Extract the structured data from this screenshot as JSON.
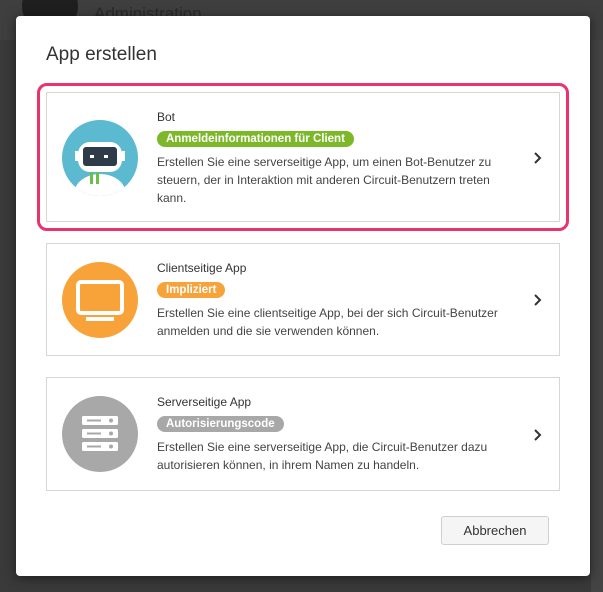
{
  "background": {
    "title": "Administration"
  },
  "dialog": {
    "title": "App erstellen",
    "options": [
      {
        "name": "Bot",
        "badge": "Anmeldeinformationen für Client",
        "badge_color": "#7cb829",
        "icon": "robot-icon",
        "icon_bg": "#5bbad0",
        "description": "Erstellen Sie eine serverseitige App, um einen Bot-Benutzer zu steuern, der in Interaktion mit anderen Circuit-Benutzern treten kann.",
        "selected": true
      },
      {
        "name": "Clientseitige App",
        "badge": "Impliziert",
        "badge_color": "#f7a33a",
        "icon": "monitor-icon",
        "icon_bg": "#f7a33a",
        "description": "Erstellen Sie eine clientseitige App, bei der sich Circuit-Benutzer anmelden und die sie verwenden können.",
        "selected": false
      },
      {
        "name": "Serverseitige App",
        "badge": "Autorisierungscode",
        "badge_color": "#a8a8a8",
        "icon": "server-icon",
        "icon_bg": "#a8a8a8",
        "description": "Erstellen Sie eine serverseitige App, die Circuit-Benutzer dazu autorisieren können, in ihrem Namen zu handeln.",
        "selected": false
      }
    ],
    "cancel_label": "Abbrechen",
    "highlight_color": "#e8336d"
  }
}
